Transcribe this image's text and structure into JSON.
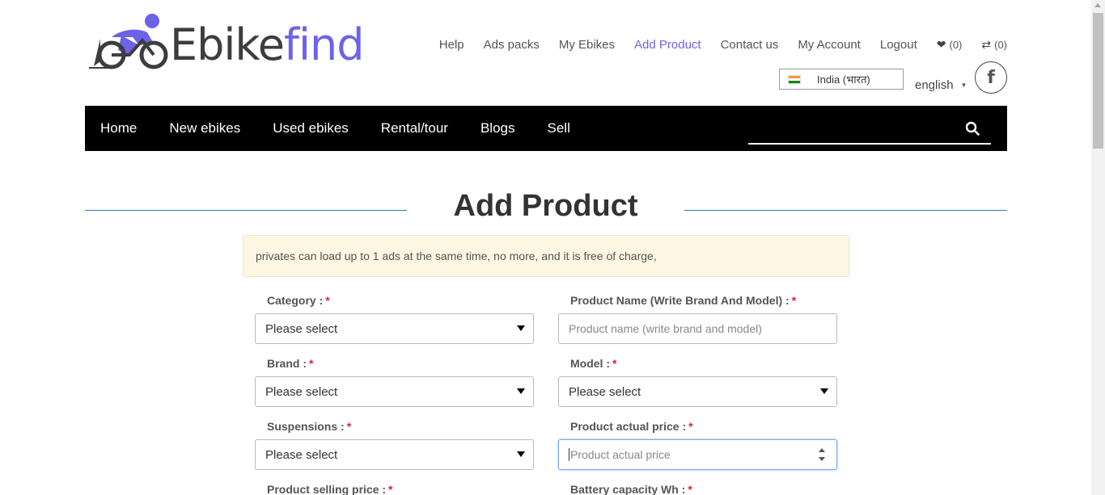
{
  "brand": {
    "name_part1": "Ebike",
    "name_part2": "find",
    "accent": "#6c63e8"
  },
  "topnav": {
    "links": [
      "Help",
      "Ads packs",
      "My Ebikes",
      "Add Product",
      "Contact us",
      "My Account",
      "Logout"
    ],
    "active": "Add Product",
    "wishlist_count": "(0)",
    "compare_count": "(0)",
    "wishlist_icon": "heart-icon",
    "compare_icon": "exchange-icon"
  },
  "locale": {
    "country": "India (भारत)",
    "language": "english",
    "social": "f"
  },
  "mainnav": {
    "items": [
      "Home",
      "New ebikes",
      "Used ebikes",
      "Rental/tour",
      "Blogs",
      "Sell"
    ],
    "search_placeholder": "",
    "search_icon": "search-icon"
  },
  "page": {
    "title": "Add Product",
    "notice": "privates can load up to 1 ads at the same time, no more, and it is free of charge,"
  },
  "form": {
    "category_label": "Category :",
    "category_value": "Please select",
    "product_name_label": "Product Name (Write Brand And Model) :",
    "product_name_placeholder": "Product name (write brand and model)",
    "brand_label": "Brand :",
    "brand_value": "Please select",
    "model_label": "Model :",
    "model_value": "Please select",
    "suspensions_label": "Suspensions :",
    "suspensions_value": "Please select",
    "actual_price_label": "Product actual price :",
    "actual_price_placeholder": "Product actual price",
    "selling_price_label": "Product selling price :",
    "battery_label": "Battery capacity Wh :",
    "required_mark": "*"
  }
}
